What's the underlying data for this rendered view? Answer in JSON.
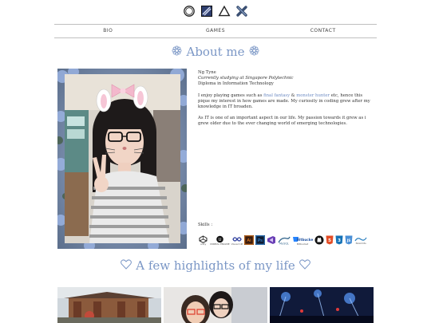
{
  "header": {
    "logos": [
      "circle-logo-icon",
      "sword-art-logo-icon",
      "triangle-logo-icon",
      "cross-logo-icon"
    ]
  },
  "nav": {
    "items": [
      {
        "label": "BIO"
      },
      {
        "label": "GAMES"
      },
      {
        "label": "CONTACT"
      }
    ]
  },
  "about": {
    "title": "About me",
    "title_icon": "flower-icon"
  },
  "bio": {
    "name": "Ng Tyne",
    "studying": "Currently studying at Singapore Polytechnic",
    "diploma": "Diploma in Information Technology",
    "para1_before": "I enjoy playing games such as ",
    "game1": "final fantasy",
    "para1_amp": " & ",
    "game2": "monster hunter",
    "para1_after": " etc, hence this pique my interest in how games are made. My curiosity in coding grew after my knowledge in IT broaden.",
    "para2": "As IT is one of an important aspect in our life. My passion towards it grew as i grew older due to the ever changing world of emerging technologies."
  },
  "skills": {
    "label": "Skills :",
    "items": [
      {
        "icon": "unity-icon",
        "caption": "unity"
      },
      {
        "icon": "unreal-engine-icon",
        "caption": "UNREAL ENGINE"
      },
      {
        "icon": "visual-c-icon",
        "caption": "Visual C#"
      },
      {
        "icon": "illustrator-icon",
        "caption": ""
      },
      {
        "icon": "photoshop-icon",
        "caption": ""
      },
      {
        "icon": "visual-studio-icon",
        "caption": ""
      },
      {
        "icon": "mysql-icon",
        "caption": ""
      },
      {
        "icon": "bitbucket-icon",
        "caption": "Bitbucket"
      },
      {
        "icon": "github-icon",
        "caption": ""
      },
      {
        "icon": "html5-icon",
        "caption": ""
      },
      {
        "icon": "css3-icon",
        "caption": ""
      },
      {
        "icon": "javascript-icon",
        "caption": ""
      },
      {
        "icon": "nolimits-icon",
        "caption": "NoLimits"
      }
    ]
  },
  "highlights": {
    "title": "A few highlights of my life",
    "icon": "heart-icon"
  },
  "colors": {
    "accent": "#7b97c6",
    "link": "#6e8cc4",
    "divider": "#bfbfbf"
  }
}
